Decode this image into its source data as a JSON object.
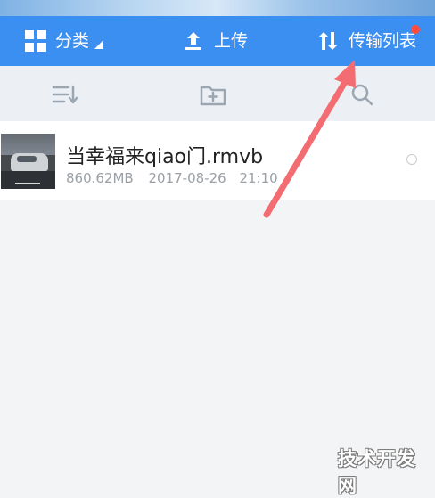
{
  "toolbar": {
    "categories_label": "分类",
    "upload_label": "上传",
    "transfer_label": "传输列表"
  },
  "file_list": [
    {
      "name": "当幸福来qiao门.rmvb",
      "size": "860.62MB",
      "date": "2017-08-26",
      "time": "21:10"
    }
  ],
  "watermark": "技术开发网",
  "icons": {
    "toolbar": [
      "grid-icon",
      "triangle-icon",
      "upload-icon",
      "transfer-icon",
      "notification-dot-icon"
    ],
    "subbar": [
      "sort-icon",
      "folder-plus-icon",
      "search-icon"
    ],
    "annotation": "red-arrow-icon"
  },
  "colors": {
    "toolbar_blue": "#3b8ff1",
    "subbar_bg": "#ecf0f4",
    "page_bg": "#f3f4f6",
    "notification_red": "#ff4c3c",
    "arrow_red": "#f36c72",
    "meta_gray": "#9aa0a6"
  }
}
